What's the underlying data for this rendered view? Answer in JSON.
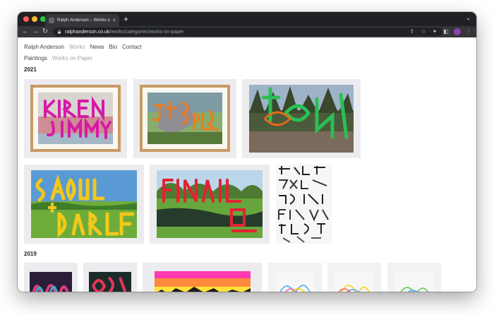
{
  "browser": {
    "tab_title": "Ralph Anderson – Works on Pa",
    "tab_close": "×",
    "new_tab": "+",
    "url_host": "ralphanderson.co.uk",
    "url_path": "/works/categories/works-on-paper",
    "icons": [
      "back-icon",
      "forward-icon",
      "reload-icon",
      "lock-icon",
      "share-icon",
      "star-icon",
      "extensions-icon",
      "sidebar-icon",
      "profile-avatar",
      "menu-icon"
    ]
  },
  "site": {
    "nav": [
      "Ralph Anderson",
      "Works",
      "News",
      "Bio",
      "Contact"
    ],
    "subnav": [
      "Paintings",
      "Works on Paper"
    ],
    "years": [
      "2021",
      "2019"
    ]
  },
  "artworks": [
    {
      "section": "2021",
      "text": "KIREN JIMMY",
      "accent": "#d61aa8"
    },
    {
      "section": "2021",
      "text": "JTS",
      "accent": "#f07a1a"
    },
    {
      "section": "2021",
      "text": "",
      "accent": "#2bbf55"
    },
    {
      "section": "2021",
      "text": "SAOUL + DARLENE",
      "accent": "#f2c81b"
    },
    {
      "section": "2021",
      "text": "",
      "accent": "#e32232"
    },
    {
      "section": "2021",
      "text": "",
      "accent": "#222222"
    },
    {
      "section": "2019",
      "text": "",
      "accent": "#e33c7a"
    },
    {
      "section": "2019",
      "text": "",
      "accent": "#e8355a"
    },
    {
      "section": "2019",
      "text": "",
      "accent": "#ff38b3"
    },
    {
      "section": "2019",
      "text": "",
      "accent": "#3fa9f5"
    },
    {
      "section": "2019",
      "text": "",
      "accent": "#ffcc00"
    },
    {
      "section": "2019",
      "text": "",
      "accent": "#5ec44d"
    }
  ]
}
